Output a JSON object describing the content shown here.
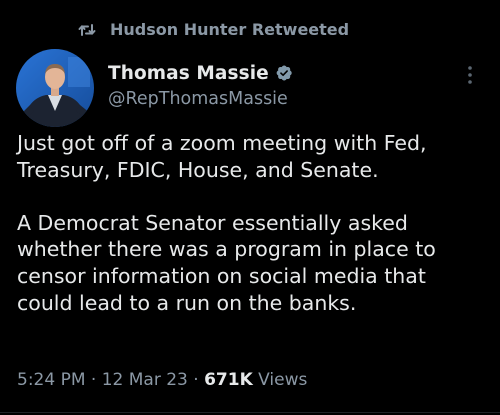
{
  "retweet": {
    "label": "Hudson Hunter Retweeted",
    "icon": "retweet-icon"
  },
  "author": {
    "display_name": "Thomas Massie",
    "handle": "@RepThomasMassie",
    "verified": true,
    "verified_badge_color": "#829aab",
    "avatar_background": "#1d5fb4"
  },
  "tweet": {
    "paragraphs": [
      "Just got off of a zoom meeting with Fed,\nTreasury, FDIC, House, and Senate.",
      "A Democrat Senator essentially asked\nwhether there was a program in place to\ncensor information on social media that\ncould lead to a run on the banks."
    ]
  },
  "meta": {
    "time": "5:24 PM",
    "separator": "·",
    "date": "12 Mar 23",
    "views_count": "671K",
    "views_label": "Views"
  },
  "colors": {
    "background": "#000000",
    "text_primary": "#e7e9ea",
    "text_secondary": "#8b98a5"
  }
}
